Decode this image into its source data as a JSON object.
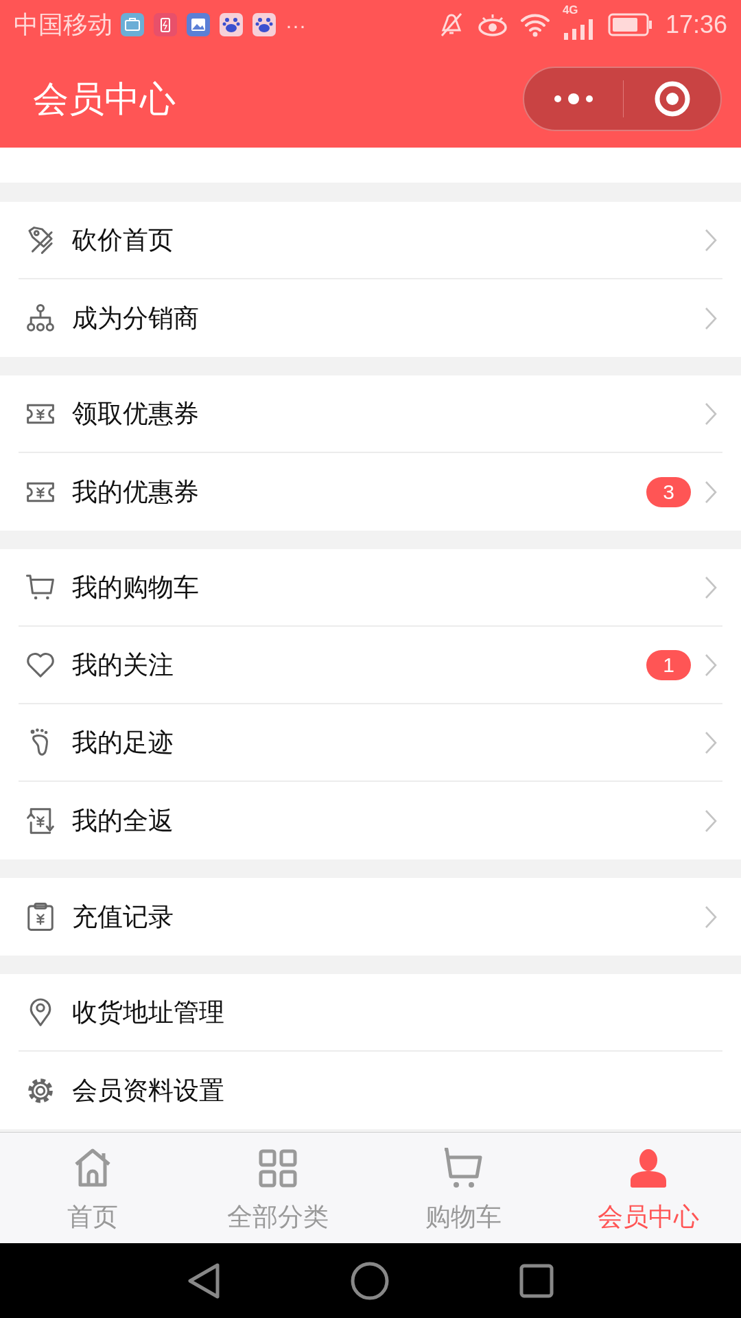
{
  "status_bar": {
    "carrier": "中国移动",
    "more": "···",
    "network": "4G",
    "time": "17:36"
  },
  "header": {
    "title": "会员中心"
  },
  "sections": [
    {
      "items": [
        {
          "label": "砍价首页"
        },
        {
          "label": "成为分销商"
        }
      ]
    },
    {
      "items": [
        {
          "label": "领取优惠券"
        },
        {
          "label": "我的优惠券",
          "badge": "3"
        }
      ]
    },
    {
      "items": [
        {
          "label": "我的购物车"
        },
        {
          "label": "我的关注",
          "badge": "1"
        },
        {
          "label": "我的足迹"
        },
        {
          "label": "我的全返"
        }
      ]
    },
    {
      "items": [
        {
          "label": "充值记录"
        }
      ]
    },
    {
      "items": [
        {
          "label": "收货地址管理",
          "chevron": false
        },
        {
          "label": "会员资料设置",
          "chevron": false
        }
      ]
    }
  ],
  "tabs": [
    {
      "label": "首页",
      "selected": false
    },
    {
      "label": "全部分类",
      "selected": false
    },
    {
      "label": "购物车",
      "selected": false
    },
    {
      "label": "会员中心",
      "selected": true
    }
  ]
}
